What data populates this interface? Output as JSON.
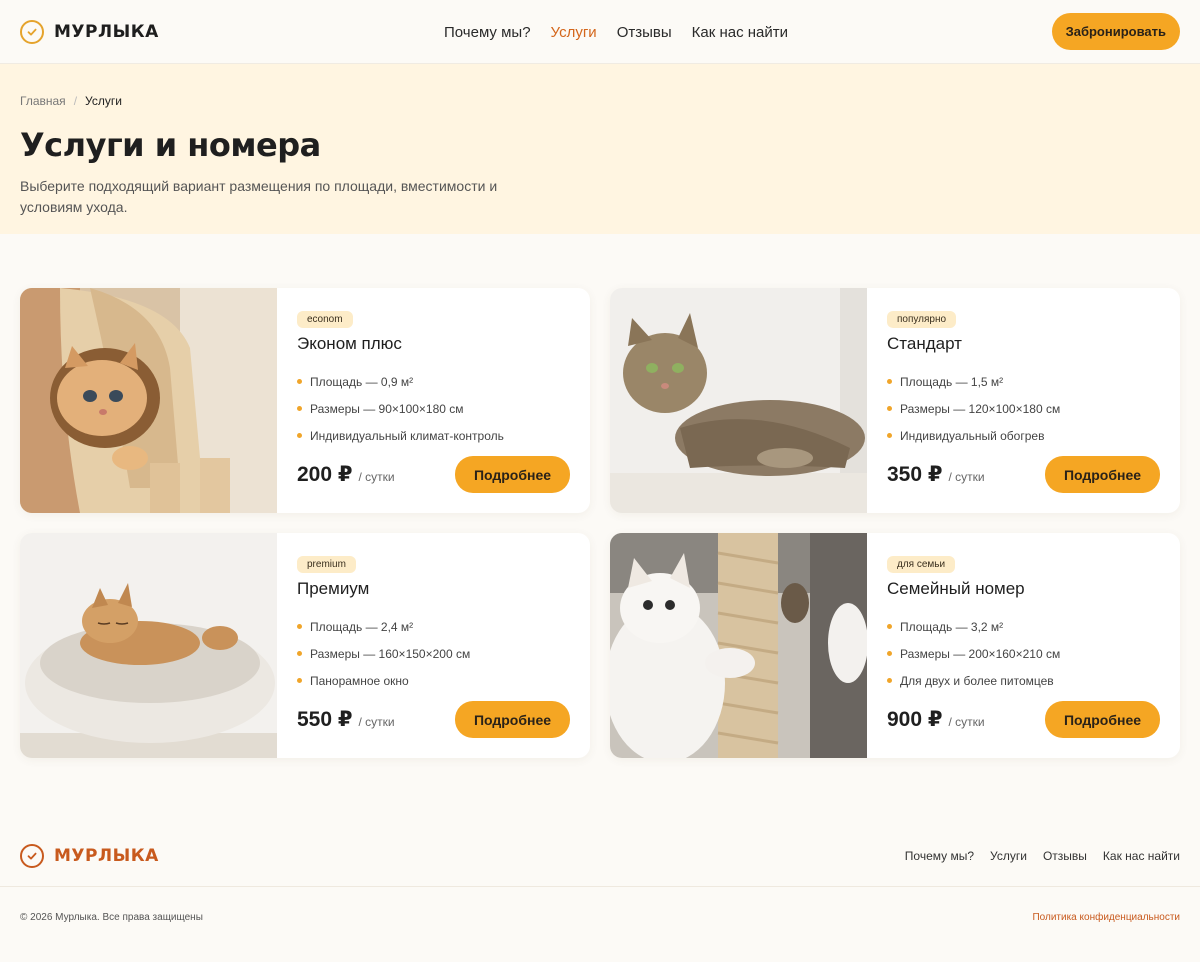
{
  "brand": {
    "name": "МУРЛЫКА"
  },
  "nav": {
    "items": [
      {
        "label": "Почему мы?"
      },
      {
        "label": "Услуги"
      },
      {
        "label": "Отзывы"
      },
      {
        "label": "Как нас найти"
      }
    ],
    "active_label": "Услуги"
  },
  "header": {
    "book_label": "Забронировать"
  },
  "breadcrumb": {
    "home": "Главная",
    "separator": "/",
    "current": "Услуги"
  },
  "hero": {
    "title": "Услуги и номера",
    "subtitle": "Выберите подходящий вариант размещения по площади, вместимости и условиям ухода."
  },
  "rooms": [
    {
      "badge": "econom",
      "title": "Эконом плюс",
      "features": [
        "Площадь — 0,9 м²",
        "Размеры — 90×100×180 см",
        "Индивидуальный климат-контроль"
      ],
      "price": "200 ₽",
      "per": "/ сутки",
      "button": "Подробнее",
      "photo": "cat-kitten-in-cat-house"
    },
    {
      "badge": "популярно",
      "title": "Стандарт",
      "features": [
        "Площадь — 1,5 м²",
        "Размеры — 120×100×180 см",
        "Индивидуальный обогрев"
      ],
      "price": "350 ₽",
      "per": "/ сутки",
      "button": "Подробнее",
      "photo": "tabby-cat-lying"
    },
    {
      "badge": "premium",
      "title": "Премиум",
      "features": [
        "Площадь — 2,4 м²",
        "Размеры — 160×150×200 см",
        "Панорамное окно"
      ],
      "price": "550 ₽",
      "per": "/ сутки",
      "button": "Подробнее",
      "photo": "cat-sleeping-in-fluffy-bed"
    },
    {
      "badge": "для семьи",
      "title": "Семейный номер",
      "features": [
        "Площадь — 3,2 м²",
        "Размеры — 200×160×210 см",
        "Для двух и более питомцев"
      ],
      "price": "900 ₽",
      "per": "/ сутки",
      "button": "Подробнее",
      "photo": "white-cats-on-scratching-post"
    }
  ],
  "footer": {
    "brand": "МУРЛЫКА",
    "nav": [
      "Почему мы?",
      "Услуги",
      "Отзывы",
      "Как нас найти"
    ],
    "copyright": "© 2026 Мурлыка. Все права защищены",
    "privacy": "Политика конфиденциальности"
  },
  "colors": {
    "accent": "#f5a623",
    "brand_orange": "#c85a1e",
    "nav_active": "#d4661b",
    "hero_bg": "#fff5e1",
    "page_bg": "#fcfaf6"
  }
}
